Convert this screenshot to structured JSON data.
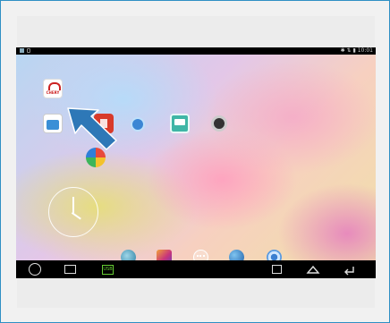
{
  "status_bar": {
    "time": "10:01",
    "indicators": "✱ ⇅ ▮"
  },
  "apps": [
    {
      "label": "",
      "icon": "chery-logo-app"
    },
    {
      "label": "",
      "icon": "store-app"
    },
    {
      "label": "",
      "icon": "red-app"
    },
    {
      "label": "",
      "icon": "settings-app"
    },
    {
      "label": "",
      "icon": "display-app"
    },
    {
      "label": "",
      "icon": "camera-app"
    },
    {
      "label": "",
      "icon": "photos-app"
    }
  ],
  "app_logo_text": "CHERY",
  "dock": [
    "browser-icon",
    "gallery-icon",
    "app-drawer-icon",
    "globe-icon",
    "settings-icon"
  ],
  "nav": {
    "usb": "USB"
  },
  "colors": {
    "accent": "#2f8fc4",
    "arrow": "#2e78b7",
    "navbar": "#000000"
  }
}
